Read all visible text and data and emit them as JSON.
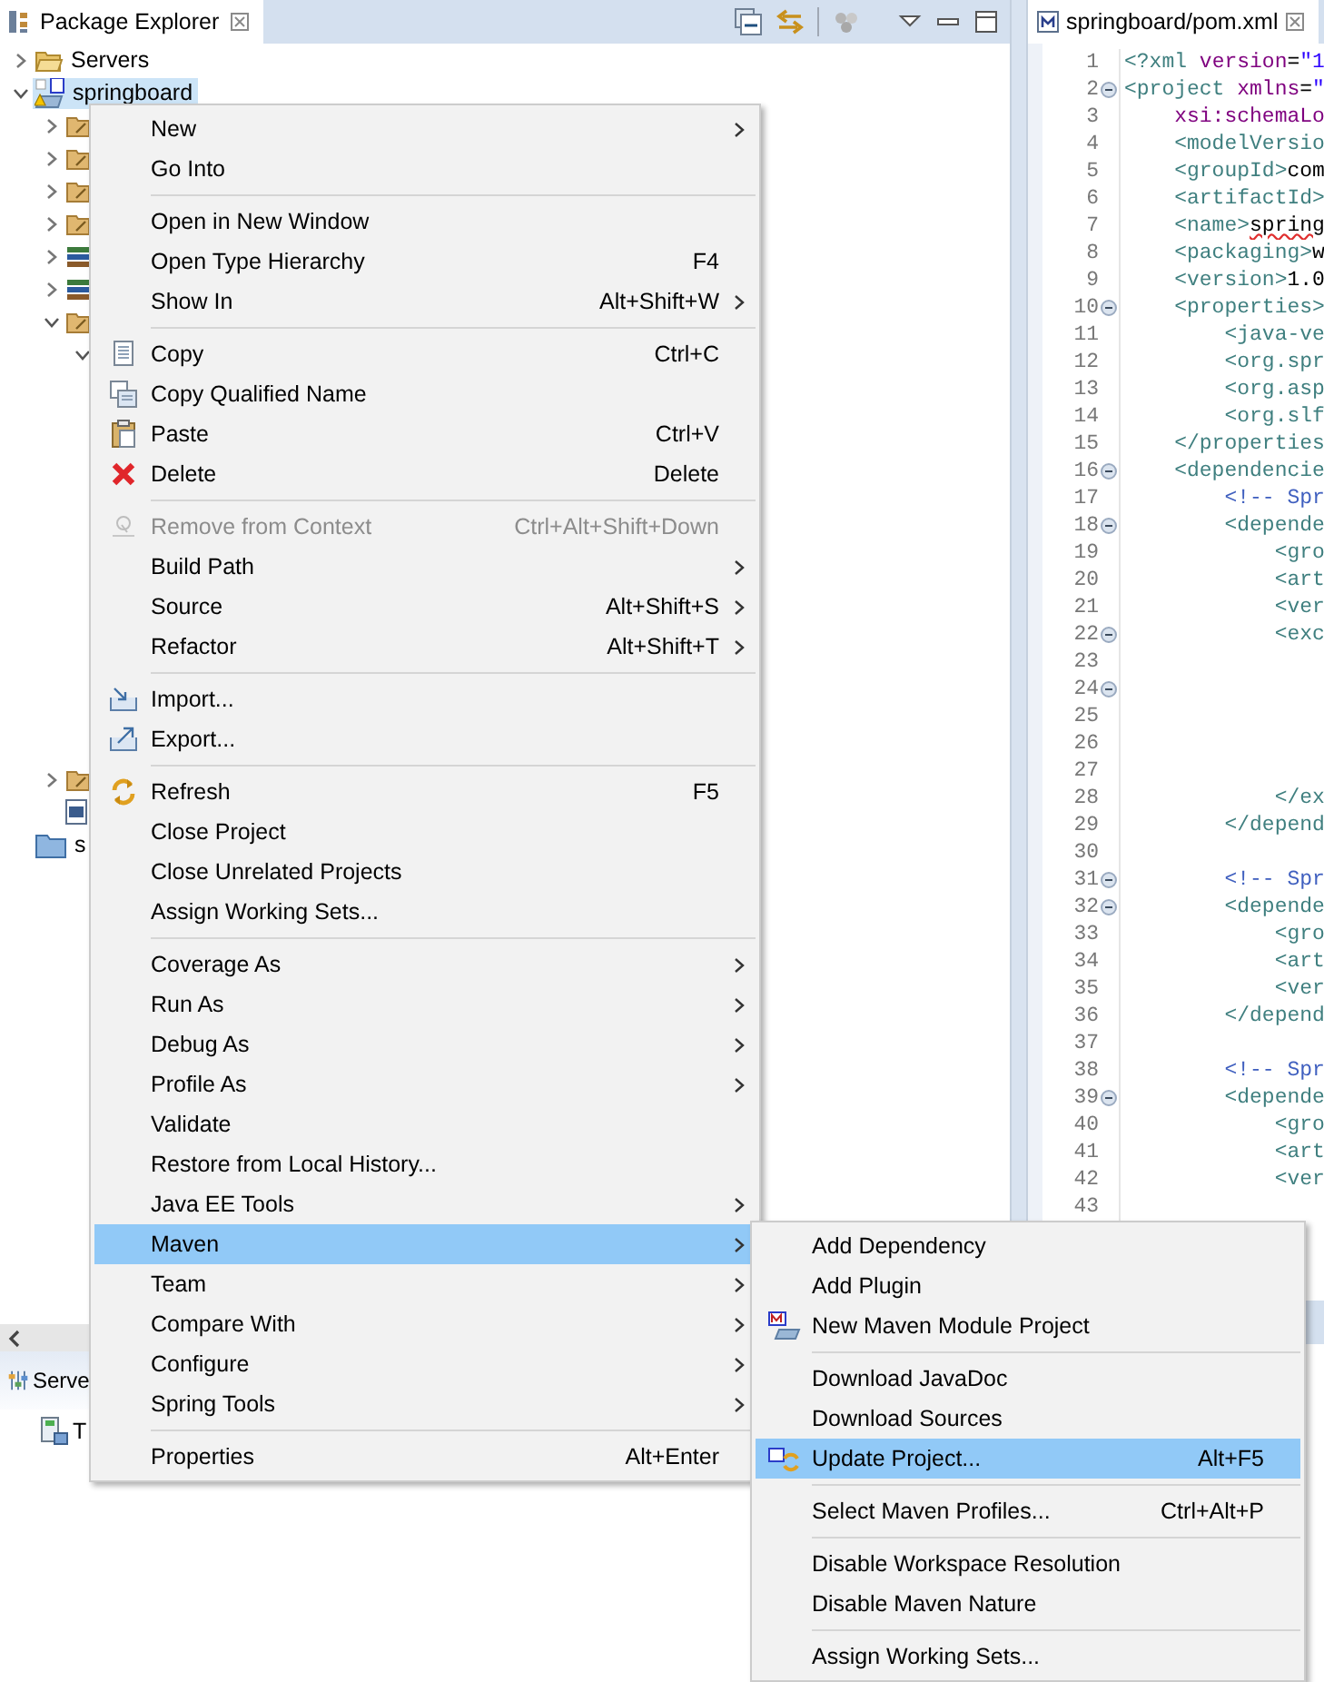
{
  "explorer": {
    "tab": {
      "title": "Package Explorer"
    },
    "tree": [
      {
        "label": "Servers",
        "kind": "folder",
        "expanded": false,
        "selected": false
      },
      {
        "label": "springboard",
        "kind": "project",
        "expanded": true,
        "selected": true,
        "children": [
          {
            "kind": "source-folder",
            "expanded": false,
            "selected": false
          },
          {
            "kind": "source-folder",
            "expanded": false,
            "selected": false
          },
          {
            "kind": "source-folder",
            "expanded": false,
            "selected": false
          },
          {
            "kind": "source-folder",
            "expanded": false,
            "selected": false
          },
          {
            "kind": "library",
            "expanded": false,
            "selected": false
          },
          {
            "kind": "library",
            "expanded": false,
            "selected": false
          },
          {
            "kind": "source-folder",
            "expanded": true,
            "selected": false,
            "children": [
              {
                "expanded": true,
                "selected": false
              }
            ]
          },
          {
            "kind": "source-folder",
            "expanded": false,
            "selected": false
          },
          {
            "kind": "file",
            "selected": false
          }
        ]
      },
      {
        "label": "s",
        "kind": "closed-project",
        "selected": false
      }
    ]
  },
  "servers_view": {
    "tab": {
      "title": "Serve"
    },
    "rows": [
      {
        "label": "T",
        "kind": "server"
      }
    ]
  },
  "editor": {
    "tab": {
      "title": "springboard/pom.xml"
    },
    "lines": [
      {
        "number": "1",
        "fold": false,
        "tokens": [
          {
            "kind": "tag",
            "text": "<?xml"
          },
          {
            "kind": "attr",
            "text": " version"
          },
          {
            "kind": "eq",
            "text": "="
          },
          {
            "kind": "string",
            "text": "\"1"
          }
        ]
      },
      {
        "number": "2",
        "fold": true,
        "tokens": [
          {
            "kind": "tag",
            "text": "<project"
          },
          {
            "kind": "attr",
            "text": " xmlns"
          },
          {
            "kind": "eq",
            "text": "="
          },
          {
            "kind": "string",
            "text": "\""
          }
        ]
      },
      {
        "number": "3",
        "fold": false,
        "tokens": [
          {
            "kind": "attr",
            "text": "    xsi:schemaLo"
          }
        ]
      },
      {
        "number": "4",
        "fold": false,
        "tokens": [
          {
            "kind": "tag",
            "text": "    <modelVersio"
          }
        ]
      },
      {
        "number": "5",
        "fold": false,
        "tokens": [
          {
            "kind": "tag",
            "text": "    <groupId>"
          },
          {
            "kind": "text",
            "text": "com"
          }
        ]
      },
      {
        "number": "6",
        "fold": false,
        "tokens": [
          {
            "kind": "tag",
            "text": "    <artifactId>"
          }
        ]
      },
      {
        "number": "7",
        "fold": false,
        "tokens": [
          {
            "kind": "tag",
            "text": "    <name>"
          },
          {
            "kind": "misspelled",
            "text": "spring"
          }
        ]
      },
      {
        "number": "8",
        "fold": false,
        "tokens": [
          {
            "kind": "tag",
            "text": "    <packaging>"
          },
          {
            "kind": "text",
            "text": "w"
          }
        ]
      },
      {
        "number": "9",
        "fold": false,
        "tokens": [
          {
            "kind": "tag",
            "text": "    <version>"
          },
          {
            "kind": "text",
            "text": "1.0"
          }
        ]
      },
      {
        "number": "10",
        "fold": true,
        "tokens": [
          {
            "kind": "tag",
            "text": "    <properties>"
          }
        ]
      },
      {
        "number": "11",
        "fold": false,
        "tokens": [
          {
            "kind": "tag",
            "text": "        <java-ve"
          }
        ]
      },
      {
        "number": "12",
        "fold": false,
        "tokens": [
          {
            "kind": "tag",
            "text": "        <org.spr"
          }
        ]
      },
      {
        "number": "13",
        "fold": false,
        "tokens": [
          {
            "kind": "tag",
            "text": "        <org.asp"
          }
        ]
      },
      {
        "number": "14",
        "fold": false,
        "tokens": [
          {
            "kind": "tag",
            "text": "        <org.slf"
          }
        ]
      },
      {
        "number": "15",
        "fold": false,
        "tokens": [
          {
            "kind": "tag",
            "text": "    </properties"
          }
        ]
      },
      {
        "number": "16",
        "fold": true,
        "tokens": [
          {
            "kind": "tag",
            "text": "    <dependencie"
          }
        ]
      },
      {
        "number": "17",
        "fold": false,
        "tokens": [
          {
            "kind": "comment",
            "text": "        <!-- Spr"
          }
        ]
      },
      {
        "number": "18",
        "fold": true,
        "tokens": [
          {
            "kind": "tag",
            "text": "        <depende"
          }
        ]
      },
      {
        "number": "19",
        "fold": false,
        "tokens": [
          {
            "kind": "tag",
            "text": "            <gro"
          }
        ]
      },
      {
        "number": "20",
        "fold": false,
        "tokens": [
          {
            "kind": "tag",
            "text": "            <art"
          }
        ]
      },
      {
        "number": "21",
        "fold": false,
        "tokens": [
          {
            "kind": "tag",
            "text": "            <ver"
          }
        ]
      },
      {
        "number": "22",
        "fold": true,
        "tokens": [
          {
            "kind": "tag",
            "text": "            <exc"
          }
        ]
      },
      {
        "number": "23",
        "fold": false
      },
      {
        "number": "24",
        "fold": true
      },
      {
        "number": "25",
        "fold": false
      },
      {
        "number": "26",
        "fold": false
      },
      {
        "number": "27",
        "fold": false
      },
      {
        "number": "28",
        "fold": false,
        "tokens": [
          {
            "kind": "tag",
            "text": "            </ex"
          }
        ]
      },
      {
        "number": "29",
        "fold": false,
        "tokens": [
          {
            "kind": "tag",
            "text": "        </depend"
          }
        ]
      },
      {
        "number": "30",
        "fold": false
      },
      {
        "number": "31",
        "fold": true,
        "tokens": [
          {
            "kind": "comment",
            "text": "        <!-- Spr"
          }
        ]
      },
      {
        "number": "32",
        "fold": true,
        "tokens": [
          {
            "kind": "tag",
            "text": "        <depende"
          }
        ]
      },
      {
        "number": "33",
        "fold": false,
        "tokens": [
          {
            "kind": "tag",
            "text": "            <gro"
          }
        ]
      },
      {
        "number": "34",
        "fold": false,
        "tokens": [
          {
            "kind": "tag",
            "text": "            <art"
          }
        ]
      },
      {
        "number": "35",
        "fold": false,
        "tokens": [
          {
            "kind": "tag",
            "text": "            <ver"
          }
        ]
      },
      {
        "number": "36",
        "fold": false,
        "tokens": [
          {
            "kind": "tag",
            "text": "        </depend"
          }
        ]
      },
      {
        "number": "37",
        "fold": false
      },
      {
        "number": "38",
        "fold": false,
        "tokens": [
          {
            "kind": "comment",
            "text": "        <!-- Spr"
          }
        ]
      },
      {
        "number": "39",
        "fold": true,
        "tokens": [
          {
            "kind": "tag",
            "text": "        <depende"
          }
        ]
      },
      {
        "number": "40",
        "fold": false,
        "tokens": [
          {
            "kind": "tag",
            "text": "            <gro"
          }
        ]
      },
      {
        "number": "41",
        "fold": false,
        "tokens": [
          {
            "kind": "tag",
            "text": "            <art"
          }
        ]
      },
      {
        "number": "42",
        "fold": false,
        "tokens": [
          {
            "kind": "tag",
            "text": "            <ver"
          }
        ]
      },
      {
        "number": "43",
        "fold": false
      }
    ]
  },
  "context_menu": {
    "sections": [
      [
        {
          "label": "New",
          "submenu": true,
          "disabled": false,
          "selected": false
        },
        {
          "label": "Go Into",
          "submenu": false,
          "disabled": false,
          "selected": false
        }
      ],
      [
        {
          "label": "Open in New Window",
          "submenu": false,
          "disabled": false,
          "selected": false
        },
        {
          "label": "Open Type Hierarchy",
          "shortcut": "F4",
          "submenu": false,
          "disabled": false,
          "selected": false
        },
        {
          "label": "Show In",
          "shortcut": "Alt+Shift+W",
          "submenu": true,
          "disabled": false,
          "selected": false
        }
      ],
      [
        {
          "label": "Copy",
          "shortcut": "Ctrl+C",
          "submenu": false,
          "disabled": false,
          "selected": false
        },
        {
          "label": "Copy Qualified Name",
          "submenu": false,
          "disabled": false,
          "selected": false
        },
        {
          "label": "Paste",
          "shortcut": "Ctrl+V",
          "submenu": false,
          "disabled": false,
          "selected": false
        },
        {
          "label": "Delete",
          "shortcut": "Delete",
          "submenu": false,
          "disabled": false,
          "selected": false
        }
      ],
      [
        {
          "label": "Remove from Context",
          "shortcut": "Ctrl+Alt+Shift+Down",
          "submenu": false,
          "disabled": true,
          "selected": false
        },
        {
          "label": "Build Path",
          "submenu": true,
          "disabled": false,
          "selected": false
        },
        {
          "label": "Source",
          "shortcut": "Alt+Shift+S",
          "submenu": true,
          "disabled": false,
          "selected": false
        },
        {
          "label": "Refactor",
          "shortcut": "Alt+Shift+T",
          "submenu": true,
          "disabled": false,
          "selected": false
        }
      ],
      [
        {
          "label": "Import...",
          "submenu": false,
          "disabled": false,
          "selected": false
        },
        {
          "label": "Export...",
          "submenu": false,
          "disabled": false,
          "selected": false
        }
      ],
      [
        {
          "label": "Refresh",
          "shortcut": "F5",
          "submenu": false,
          "disabled": false,
          "selected": false
        },
        {
          "label": "Close Project",
          "submenu": false,
          "disabled": false,
          "selected": false
        },
        {
          "label": "Close Unrelated Projects",
          "submenu": false,
          "disabled": false,
          "selected": false
        },
        {
          "label": "Assign Working Sets...",
          "submenu": false,
          "disabled": false,
          "selected": false
        }
      ],
      [
        {
          "label": "Coverage As",
          "submenu": true,
          "disabled": false,
          "selected": false
        },
        {
          "label": "Run As",
          "submenu": true,
          "disabled": false,
          "selected": false
        },
        {
          "label": "Debug As",
          "submenu": true,
          "disabled": false,
          "selected": false
        },
        {
          "label": "Profile As",
          "submenu": true,
          "disabled": false,
          "selected": false
        },
        {
          "label": "Validate",
          "submenu": false,
          "disabled": false,
          "selected": false
        },
        {
          "label": "Restore from Local History...",
          "submenu": false,
          "disabled": false,
          "selected": false
        },
        {
          "label": "Java EE Tools",
          "submenu": true,
          "disabled": false,
          "selected": false
        },
        {
          "label": "Maven",
          "submenu": true,
          "disabled": false,
          "selected": true
        },
        {
          "label": "Team",
          "submenu": true,
          "disabled": false,
          "selected": false
        },
        {
          "label": "Compare With",
          "submenu": true,
          "disabled": false,
          "selected": false
        },
        {
          "label": "Configure",
          "submenu": true,
          "disabled": false,
          "selected": false
        },
        {
          "label": "Spring Tools",
          "submenu": true,
          "disabled": false,
          "selected": false
        }
      ],
      [
        {
          "label": "Properties",
          "shortcut": "Alt+Enter",
          "submenu": false,
          "disabled": false,
          "selected": false
        }
      ]
    ]
  },
  "maven_submenu": {
    "sections": [
      [
        {
          "label": "Add Dependency",
          "submenu": false,
          "disabled": false,
          "selected": false
        },
        {
          "label": "Add Plugin",
          "submenu": false,
          "disabled": false,
          "selected": false
        },
        {
          "label": "New Maven Module Project",
          "submenu": false,
          "disabled": false,
          "selected": false
        }
      ],
      [
        {
          "label": "Download JavaDoc",
          "submenu": false,
          "disabled": false,
          "selected": false
        },
        {
          "label": "Download Sources",
          "submenu": false,
          "disabled": false,
          "selected": false
        },
        {
          "label": "Update Project...",
          "shortcut": "Alt+F5",
          "submenu": false,
          "disabled": false,
          "selected": true
        }
      ],
      [
        {
          "label": "Select Maven Profiles...",
          "shortcut": "Ctrl+Alt+P",
          "submenu": false,
          "disabled": false,
          "selected": false
        }
      ],
      [
        {
          "label": "Disable Workspace Resolution",
          "submenu": false,
          "disabled": false,
          "selected": false
        },
        {
          "label": "Disable Maven Nature",
          "submenu": false,
          "disabled": false,
          "selected": false
        }
      ],
      [
        {
          "label": "Assign Working Sets...",
          "submenu": false,
          "disabled": false,
          "selected": false
        }
      ]
    ]
  }
}
